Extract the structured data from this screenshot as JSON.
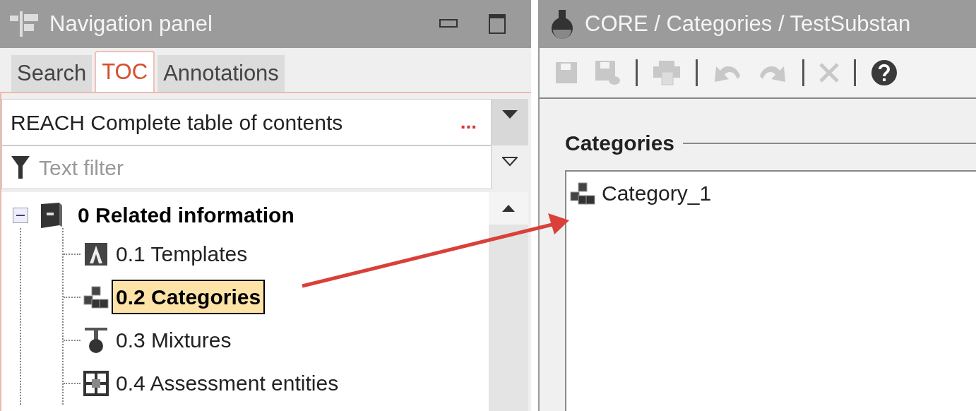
{
  "navigation_panel": {
    "title": "Navigation panel",
    "tabs": [
      {
        "label": "Search",
        "selected": false
      },
      {
        "label": "TOC",
        "selected": true
      },
      {
        "label": "Annotations",
        "selected": false
      }
    ],
    "toc_dropdown": {
      "value": "REACH Complete table of contents",
      "more": "..."
    },
    "filter": {
      "placeholder": "Text filter"
    },
    "tree": [
      {
        "label": "0 Related information",
        "kind": "folder",
        "expanded": true,
        "selected": false,
        "children": [
          {
            "label": "0.1 Templates",
            "kind": "templates",
            "selected": false
          },
          {
            "label": "0.2 Categories",
            "kind": "categories",
            "selected": true
          },
          {
            "label": "0.3 Mixtures",
            "kind": "mixtures",
            "selected": false
          },
          {
            "label": "0.4 Assessment entities",
            "kind": "assessment",
            "selected": false
          }
        ]
      }
    ]
  },
  "editor": {
    "title": "CORE / Categories / TestSubstan",
    "toolbar": [
      {
        "kind": "save",
        "disabled": true
      },
      {
        "kind": "save-comment",
        "disabled": true
      },
      {
        "kind": "separator"
      },
      {
        "kind": "print",
        "disabled": true
      },
      {
        "kind": "separator"
      },
      {
        "kind": "undo",
        "disabled": true
      },
      {
        "kind": "redo",
        "disabled": true
      },
      {
        "kind": "separator"
      },
      {
        "kind": "delete",
        "disabled": true
      },
      {
        "kind": "separator"
      },
      {
        "kind": "help",
        "disabled": false
      }
    ],
    "section_title": "Categories",
    "items": [
      {
        "label": "Category_1",
        "kind": "categories"
      }
    ]
  }
}
